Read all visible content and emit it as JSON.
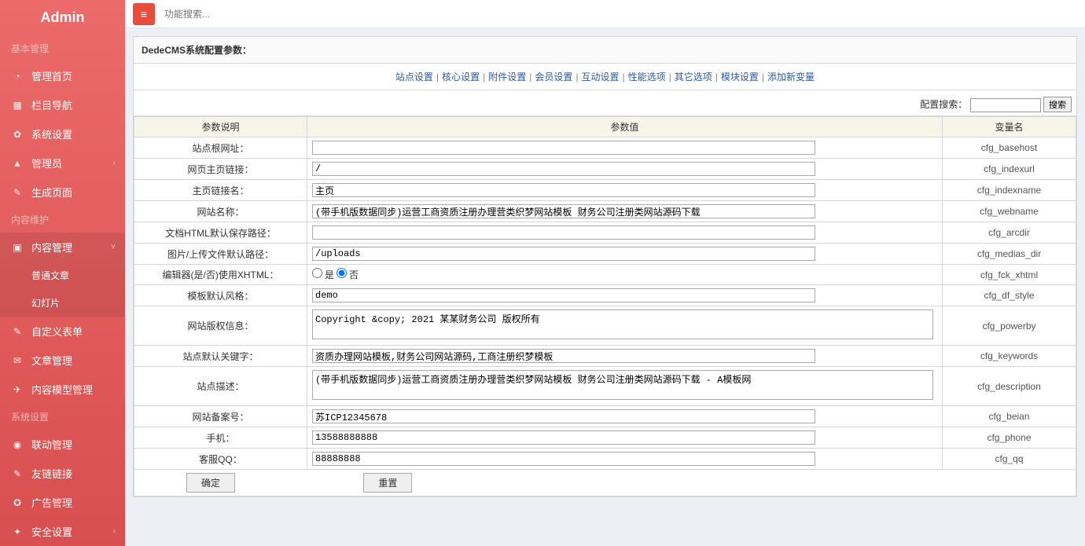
{
  "brand": "Admin",
  "topbar": {
    "search_placeholder": "功能搜索..."
  },
  "sidebar": {
    "sections": [
      {
        "title": "基本管理",
        "items": [
          {
            "icon": "◔",
            "label": "管理首页"
          },
          {
            "icon": "▦",
            "label": "栏目导航"
          },
          {
            "icon": "✿",
            "label": "系统设置"
          },
          {
            "icon": "▲",
            "label": "管理员",
            "arrow": "‹"
          },
          {
            "icon": "✎",
            "label": "生成页面"
          }
        ]
      },
      {
        "title": "内容维护",
        "items": [
          {
            "icon": "▣",
            "label": "内容管理",
            "arrow": "˅",
            "active": true
          },
          {
            "sub": true,
            "label": "普通文章"
          },
          {
            "sub": true,
            "label": "幻灯片"
          },
          {
            "icon": "✎",
            "label": "自定义表单"
          },
          {
            "icon": "✉",
            "label": "文章管理"
          },
          {
            "icon": "✈",
            "label": "内容模型管理"
          }
        ]
      },
      {
        "title": "系统设置",
        "items": [
          {
            "icon": "◉",
            "label": "联动管理"
          },
          {
            "icon": "✎",
            "label": "友链链接"
          },
          {
            "icon": "✪",
            "label": "广告管理"
          },
          {
            "icon": "✦",
            "label": "安全设置",
            "arrow": "‹"
          }
        ]
      }
    ]
  },
  "panel": {
    "title": "DedeCMS系统配置参数：",
    "tabs": [
      "站点设置",
      "核心设置",
      "附件设置",
      "会员设置",
      "互动设置",
      "性能选项",
      "其它选项",
      "模块设置",
      "添加新变量"
    ],
    "search_label": "配置搜索：",
    "search_btn": "搜索",
    "headers": {
      "desc": "参数说明",
      "value": "参数值",
      "var": "变量名"
    },
    "rows": [
      {
        "label": "站点根网址：",
        "type": "text",
        "value": "",
        "var": "cfg_basehost"
      },
      {
        "label": "网页主页链接：",
        "type": "text",
        "value": "/",
        "var": "cfg_indexurl"
      },
      {
        "label": "主页链接名：",
        "type": "text",
        "value": "主页",
        "var": "cfg_indexname"
      },
      {
        "label": "网站名称：",
        "type": "text",
        "value": "(带手机版数据同步)运营工商资质注册办理营类织梦网站模板 财务公司注册类网站源码下载",
        "var": "cfg_webname"
      },
      {
        "label": "文档HTML默认保存路径：",
        "type": "text",
        "value": "",
        "var": "cfg_arcdir"
      },
      {
        "label": "图片/上传文件默认路径：",
        "type": "text",
        "value": "/uploads",
        "var": "cfg_medias_dir"
      },
      {
        "label": "编辑器(是/否)使用XHTML：",
        "type": "radio",
        "yes": "是",
        "no": "否",
        "value": "no",
        "var": "cfg_fck_xhtml"
      },
      {
        "label": "模板默认风格：",
        "type": "text",
        "value": "demo",
        "var": "cfg_df_style"
      },
      {
        "label": "网站版权信息：",
        "type": "textarea",
        "value": "Copyright &copy; 2021 某某财务公司 版权所有",
        "var": "cfg_powerby"
      },
      {
        "label": "站点默认关键字：",
        "type": "text",
        "value": "资质办理网站模板,财务公司网站源码,工商注册织梦模板",
        "var": "cfg_keywords"
      },
      {
        "label": "站点描述：",
        "type": "textarea",
        "value": "(带手机版数据同步)运营工商资质注册办理营类织梦网站模板 财务公司注册类网站源码下载 - A模板网",
        "var": "cfg_description"
      },
      {
        "label": "网站备案号：",
        "type": "text",
        "value": "苏ICP12345678",
        "var": "cfg_beian"
      },
      {
        "label": "手机：",
        "type": "text",
        "value": "13588888888",
        "var": "cfg_phone"
      },
      {
        "label": "客服QQ：",
        "type": "text",
        "value": "88888888",
        "var": "cfg_qq"
      }
    ],
    "buttons": {
      "ok": "确定",
      "reset": "重置"
    }
  }
}
